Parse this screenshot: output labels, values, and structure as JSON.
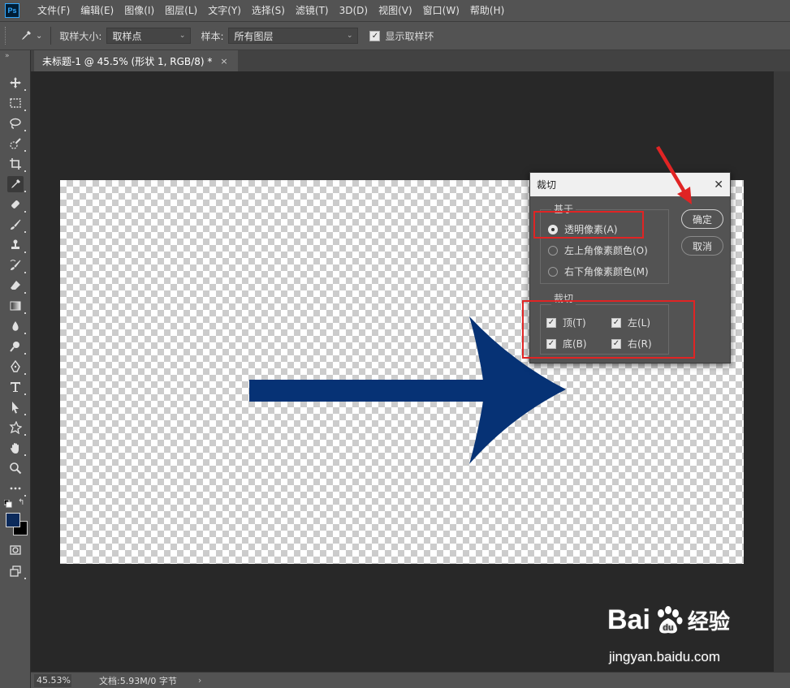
{
  "app": {
    "logo_text": "Ps",
    "menu": [
      "文件(F)",
      "编辑(E)",
      "图像(I)",
      "图层(L)",
      "文字(Y)",
      "选择(S)",
      "滤镜(T)",
      "3D(D)",
      "视图(V)",
      "窗口(W)",
      "帮助(H)"
    ]
  },
  "options": {
    "sample_size_label": "取样大小:",
    "sample_size_value": "取样点",
    "sample_label": "样本:",
    "sample_value": "所有图层",
    "show_ring_label": "显示取样环"
  },
  "document": {
    "tab_title": "未标题-1 @ 45.5% (形状 1, RGB/8) *",
    "tab_close": "×",
    "arrow_color": "#063275"
  },
  "status": {
    "zoom": "45.53%",
    "doc_info": "文档:5.93M/0 字节",
    "arrow": "›"
  },
  "dialog": {
    "title": "裁切",
    "close": "✕",
    "based_on_legend": "基于",
    "radio_options": [
      {
        "label": "透明像素(A)",
        "checked": true
      },
      {
        "label": "左上角像素颜色(O)",
        "checked": false
      },
      {
        "label": "右下角像素颜色(M)",
        "checked": false
      }
    ],
    "trim_legend": "裁切",
    "checks": [
      {
        "label": "顶(T)",
        "checked": true
      },
      {
        "label": "左(L)",
        "checked": true
      },
      {
        "label": "底(B)",
        "checked": true
      },
      {
        "label": "右(R)",
        "checked": true
      }
    ],
    "ok_label": "确定",
    "cancel_label": "取消"
  },
  "watermark": {
    "brand_left": "Bai",
    "brand_right": "经验",
    "url": "jingyan.baidu.com"
  },
  "colors": {
    "annotation": "#e02424",
    "foreground_swatch": "#0b2a5b",
    "background_swatch": "#000000"
  }
}
